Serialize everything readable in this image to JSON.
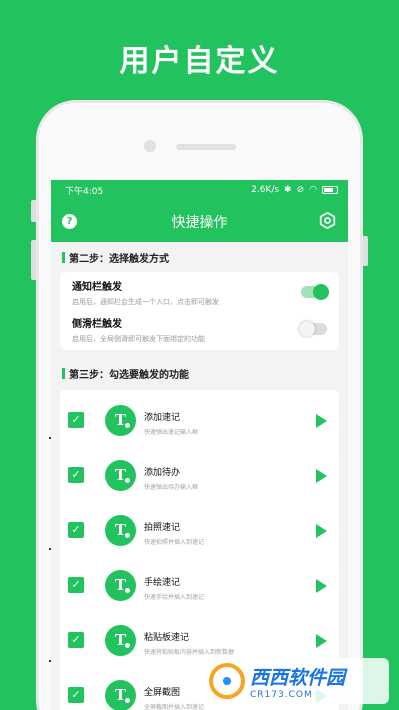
{
  "headline": "用户自定义",
  "status_bar": {
    "time": "下午4:05",
    "speed": "2.6K/s"
  },
  "app_bar": {
    "title": "快捷操作",
    "help_glyph": "?"
  },
  "step2": {
    "title": "第二步：选择触发方式",
    "options": [
      {
        "name": "通知栏触发",
        "desc": "启用后，通知栏会生成一个入口，点击即可触发",
        "enabled": true
      },
      {
        "name": "侧滑栏触发",
        "desc": "启用后，全局侧滑即可触发下面绑定的功能",
        "enabled": false
      }
    ]
  },
  "step3": {
    "title": "第三步：勾选要触发的功能",
    "functions": [
      {
        "name": "添加速记",
        "desc": "快速弹出速记输入框",
        "checked": true
      },
      {
        "name": "添加待办",
        "desc": "快速弹出待办输入框",
        "checked": true
      },
      {
        "name": "拍照速记",
        "desc": "快速拍照并插入到速记",
        "checked": true
      },
      {
        "name": "手绘速记",
        "desc": "快速手绘并插入到速记",
        "checked": true
      },
      {
        "name": "粘贴板速记",
        "desc": "快速将粘贴板内容并插入到新数据",
        "checked": true
      },
      {
        "name": "全屏截图",
        "desc": "全屏截图并插入到速记",
        "checked": true
      }
    ]
  },
  "watermark": {
    "line1": "西西软件园",
    "line2": "CR173.COM"
  },
  "colors": {
    "brand": "#22c35e",
    "background": "#f3f3f3"
  },
  "icons": {
    "help": "question-circle-icon",
    "settings": "hexagon-gear-icon",
    "function": "t-note-icon",
    "run": "play-triangle-icon",
    "check": "checkbox-checked-icon"
  }
}
